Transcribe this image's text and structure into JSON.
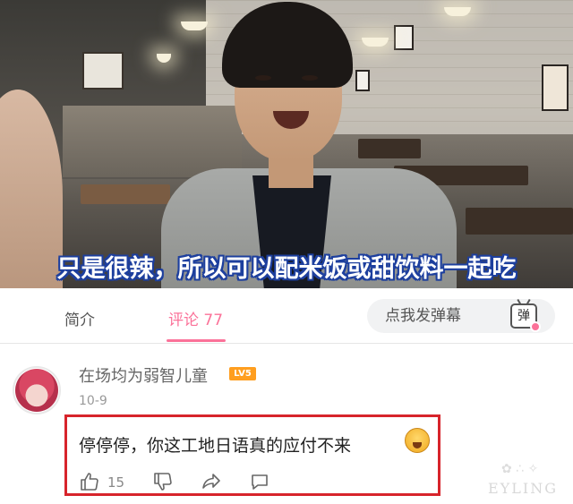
{
  "video": {
    "subtitle": "只是很辣，所以可以配米饭或甜饮料一起吃"
  },
  "tabs": {
    "intro_label": "简介",
    "comments_label": "评论 77"
  },
  "danmaku": {
    "placeholder": "点我发弹幕",
    "button_glyph": "弹"
  },
  "comment": {
    "username": "在场均为弱智儿童",
    "level": "LV5",
    "date": "10-9",
    "text": "停停停，你这工地日语真的应付不来",
    "like_count": "15"
  },
  "watermark": {
    "text": "EYLING"
  },
  "colors": {
    "accent": "#fb7299",
    "highlight_border": "#d7242b",
    "level_badge": "#ff9e1f",
    "subtitle_outline": "#1d3f9e"
  },
  "icons": {
    "like": "thumb-up-icon",
    "dislike": "thumb-down-icon",
    "share": "share-icon",
    "reply": "comment-bubble-icon",
    "emoji": "emoji-icon",
    "danmaku": "danmaku-tv-icon"
  }
}
